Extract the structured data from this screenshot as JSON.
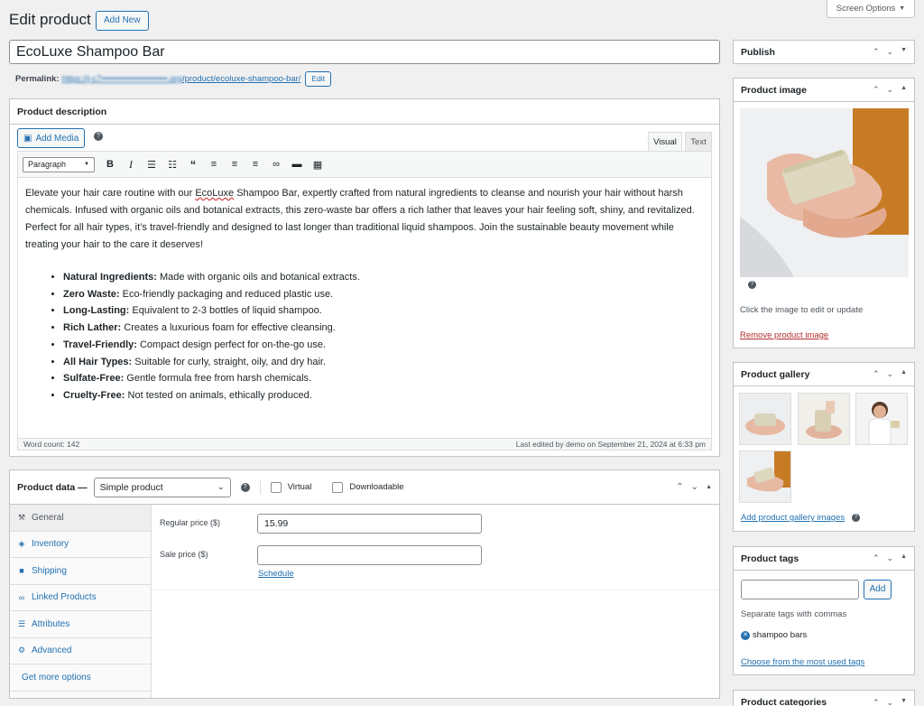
{
  "header": {
    "title": "Edit product",
    "add_new": "Add New",
    "screen_options": "Screen Options"
  },
  "product": {
    "title": "EcoLuxe Shampoo Bar",
    "permalink_label": "Permalink:",
    "permalink_url": "https://j-c7...sandbox.org/product/ecoluxe-shampoo-bar/",
    "permalink_host": "https://j-c7••••••••••••••••••••••.org",
    "permalink_path": "/product/ecoluxe-shampoo-bar/",
    "permalink_edit": "Edit"
  },
  "description": {
    "heading": "Product description",
    "add_media": "Add Media",
    "tab_visual": "Visual",
    "tab_text": "Text",
    "format_select": "Paragraph",
    "intro_1": "Elevate your hair care routine with our ",
    "intro_brand": "EcoLuxe",
    "intro_2": " Shampoo Bar, expertly crafted from natural ingredients to cleanse and nourish your hair without harsh chemicals. Infused with organic oils and botanical extracts, this zero-waste bar offers a rich lather that leaves your hair feeling soft, shiny, and revitalized. Perfect for all hair types, it’s travel-friendly and designed to last longer than traditional liquid shampoos. Join the sustainable beauty movement while treating your hair to the care it deserves!",
    "features": [
      {
        "bold": "Natural Ingredients:",
        "text": " Made with organic oils and botanical extracts."
      },
      {
        "bold": "Zero Waste:",
        "text": " Eco-friendly packaging and reduced plastic use."
      },
      {
        "bold": "Long-Lasting:",
        "text": " Equivalent to 2-3 bottles of liquid shampoo."
      },
      {
        "bold": "Rich Lather:",
        "text": " Creates a luxurious foam for effective cleansing."
      },
      {
        "bold": "Travel-Friendly:",
        "text": " Compact design perfect for on-the-go use."
      },
      {
        "bold": "All Hair Types:",
        "text": " Suitable for curly, straight, oily, and dry hair."
      },
      {
        "bold": "Sulfate-Free:",
        "text": " Gentle formula free from harsh chemicals."
      },
      {
        "bold": "Cruelty-Free:",
        "text": " Not tested on animals, ethically produced."
      }
    ],
    "word_count": "Word count: 142",
    "last_edited": "Last edited by demo on September 21, 2024 at 6:33 pm"
  },
  "product_data": {
    "label": "Product data —",
    "type_select": "Simple product",
    "virtual": "Virtual",
    "downloadable": "Downloadable",
    "tabs": [
      {
        "label": "General",
        "icon": "wrench-icon",
        "glyph": "⚒"
      },
      {
        "label": "Inventory",
        "icon": "tag-icon",
        "glyph": "◈"
      },
      {
        "label": "Shipping",
        "icon": "truck-icon",
        "glyph": "■"
      },
      {
        "label": "Linked Products",
        "icon": "link-icon",
        "glyph": "∞"
      },
      {
        "label": "Attributes",
        "icon": "list-icon",
        "glyph": "☰"
      },
      {
        "label": "Advanced",
        "icon": "gear-icon",
        "glyph": "⚙"
      },
      {
        "label": "Get more options",
        "icon": "",
        "glyph": ""
      }
    ],
    "regular_price_label": "Regular price ($)",
    "regular_price": "15.99",
    "sale_price_label": "Sale price ($)",
    "sale_price": "",
    "schedule": "Schedule"
  },
  "sidebar": {
    "publish": "Publish",
    "product_image": {
      "heading": "Product image",
      "hint": "Click the image to edit or update",
      "remove": "Remove product image"
    },
    "gallery": {
      "heading": "Product gallery",
      "add": "Add product gallery images"
    },
    "tags": {
      "heading": "Product tags",
      "add": "Add",
      "hint": "Separate tags with commas",
      "tag": "shampoo bars",
      "choose": "Choose from the most used tags"
    },
    "categories": {
      "heading": "Product categories"
    }
  },
  "colors": {
    "accent": "#2271b1",
    "danger": "#b32d2e"
  }
}
